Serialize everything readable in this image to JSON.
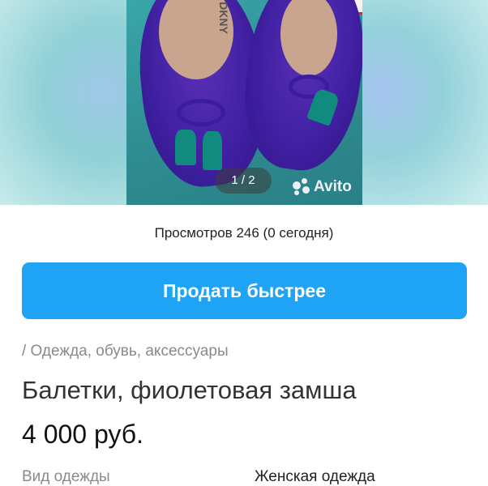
{
  "gallery": {
    "brand_text": "DKNY",
    "counter": "1 / 2",
    "watermark": "Avito"
  },
  "listing": {
    "views": "Просмотров 246 (0 сегодня)",
    "sell_button": "Продать быстрее",
    "breadcrumb": "/ Одежда, обувь, аксессуары",
    "title": "Балетки, фиолетовая замша",
    "price": "4 000 руб.",
    "params": [
      {
        "label": "Вид одежды",
        "value": "Женская одежда"
      }
    ]
  },
  "colors": {
    "accent": "#1fa3f5",
    "shoe": "#3f1fa0",
    "tassel": "#118b7e"
  }
}
